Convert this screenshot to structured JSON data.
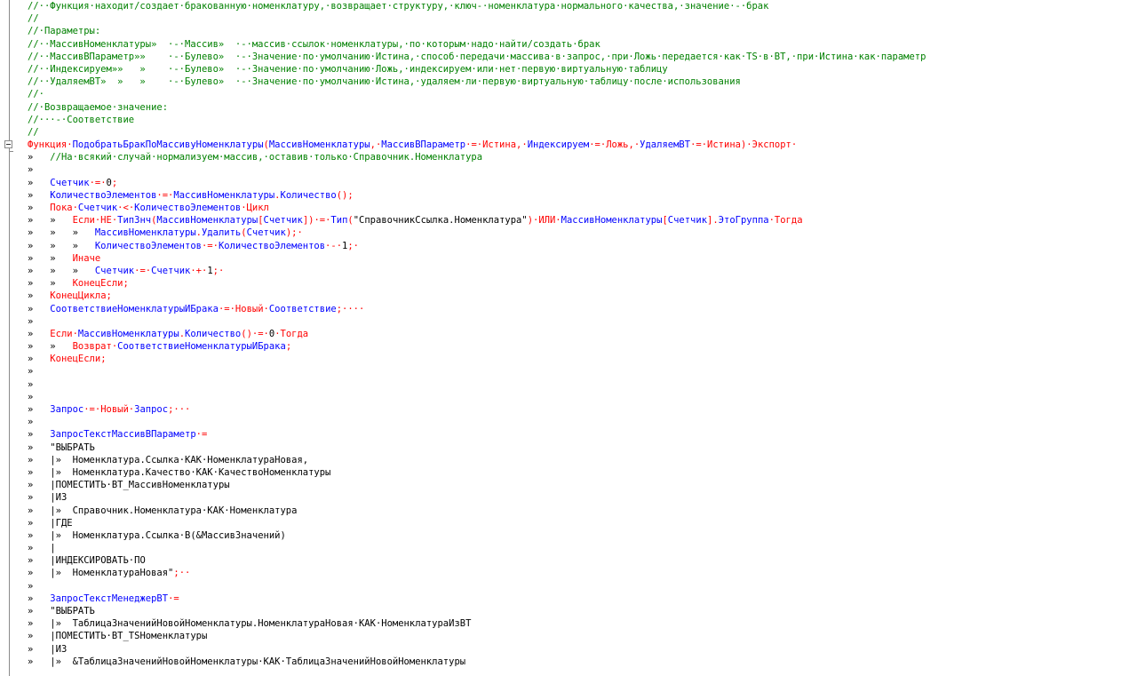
{
  "editor": {
    "lines": [
      [
        {
          "t": "//··Функция·находит/создает·бракованную·номенклатуру,·возвращает·структуру,·ключ-·номенклатура·нормального·качества,·значение·-·брак",
          "c": "c"
        }
      ],
      [
        {
          "t": "//",
          "c": "c"
        }
      ],
      [
        {
          "t": "//·Параметры:",
          "c": "c"
        }
      ],
      [
        {
          "t": "//··МассивНоменклатуры»  ·-·Массив»  ·-·массив·ссылок·номенклатуры,·по·которым·надо·найти/создать·брак",
          "c": "c"
        }
      ],
      [
        {
          "t": "//··МассивВПараметр»»    ·-·Булево»  ·-·Значение·по·умолчанию·Истина,·способ·передачи·массива·в·запрос,·при·Ложь·передается·как·TS·в·ВТ,·при·Истина·как·параметр",
          "c": "c"
        }
      ],
      [
        {
          "t": "//··Индексируем»»   »    ·-·Булево»  ·-·Значение·по·умолчанию·Ложь,·индексируем·или·нет·первую·виртуальную·таблицу",
          "c": "c"
        }
      ],
      [
        {
          "t": "//··УдаляемВТ»  »   »    ·-·Булево»  ·-·Значение·по·умолчанию·Истина,·удаляем·ли·первую·виртуальную·таблицу·после·использования",
          "c": "c"
        }
      ],
      [
        {
          "t": "//·",
          "c": "c"
        }
      ],
      [
        {
          "t": "//·Возвращаемое·значение:",
          "c": "c"
        }
      ],
      [
        {
          "t": "//···-·Соответствие",
          "c": "c"
        }
      ],
      [
        {
          "t": "//",
          "c": "c"
        }
      ],
      [
        {
          "t": "Функция·",
          "c": "k"
        },
        {
          "t": "ПодобратьБракПоМассивуНоменклатуры",
          "c": "i"
        },
        {
          "t": "(",
          "c": "o"
        },
        {
          "t": "МассивНоменклатуры",
          "c": "i"
        },
        {
          "t": ",·",
          "c": "o"
        },
        {
          "t": "МассивВПараметр",
          "c": "i"
        },
        {
          "t": "·=·",
          "c": "o"
        },
        {
          "t": "Истина",
          "c": "k"
        },
        {
          "t": ",·",
          "c": "o"
        },
        {
          "t": "Индексируем",
          "c": "i"
        },
        {
          "t": "·=·",
          "c": "o"
        },
        {
          "t": "Ложь",
          "c": "k"
        },
        {
          "t": ",·",
          "c": "o"
        },
        {
          "t": "УдаляемВТ",
          "c": "i"
        },
        {
          "t": "·=·",
          "c": "o"
        },
        {
          "t": "Истина",
          "c": "k"
        },
        {
          "t": ")·",
          "c": "o"
        },
        {
          "t": "Экспорт",
          "c": "k"
        },
        {
          "t": "·",
          "c": "o"
        }
      ],
      [
        {
          "t": "»   ",
          "c": "n"
        },
        {
          "t": "//На·всякий·случай·нормализуем·массив,·оставив·только·Справочник.Номенклатура",
          "c": "c"
        }
      ],
      [
        {
          "t": "»",
          "c": "n"
        }
      ],
      [
        {
          "t": "»   ",
          "c": "n"
        },
        {
          "t": "Счетчик",
          "c": "i"
        },
        {
          "t": "·=·",
          "c": "o"
        },
        {
          "t": "0",
          "c": "n"
        },
        {
          "t": ";",
          "c": "o"
        }
      ],
      [
        {
          "t": "»   ",
          "c": "n"
        },
        {
          "t": "КоличествоЭлементов",
          "c": "i"
        },
        {
          "t": "·=·",
          "c": "o"
        },
        {
          "t": "МассивНоменклатуры",
          "c": "i"
        },
        {
          "t": ".",
          "c": "o"
        },
        {
          "t": "Количество",
          "c": "i"
        },
        {
          "t": "();",
          "c": "o"
        }
      ],
      [
        {
          "t": "»   ",
          "c": "n"
        },
        {
          "t": "Пока·",
          "c": "k"
        },
        {
          "t": "Счетчик",
          "c": "i"
        },
        {
          "t": "·<·",
          "c": "o"
        },
        {
          "t": "КоличествоЭлементов",
          "c": "i"
        },
        {
          "t": "·Цикл",
          "c": "k"
        }
      ],
      [
        {
          "t": "»   »   ",
          "c": "n"
        },
        {
          "t": "Если·НЕ·",
          "c": "k"
        },
        {
          "t": "ТипЗнч",
          "c": "i"
        },
        {
          "t": "(",
          "c": "o"
        },
        {
          "t": "МассивНоменклатуры",
          "c": "i"
        },
        {
          "t": "[",
          "c": "o"
        },
        {
          "t": "Счетчик",
          "c": "i"
        },
        {
          "t": "])·=·",
          "c": "o"
        },
        {
          "t": "Тип",
          "c": "i"
        },
        {
          "t": "(",
          "c": "o"
        },
        {
          "t": "\"СправочникСсылка.Номенклатура\"",
          "c": "s"
        },
        {
          "t": ")·",
          "c": "o"
        },
        {
          "t": "ИЛИ·",
          "c": "k"
        },
        {
          "t": "МассивНоменклатуры",
          "c": "i"
        },
        {
          "t": "[",
          "c": "o"
        },
        {
          "t": "Счетчик",
          "c": "i"
        },
        {
          "t": "].",
          "c": "o"
        },
        {
          "t": "ЭтоГруппа",
          "c": "i"
        },
        {
          "t": "·Тогда",
          "c": "k"
        }
      ],
      [
        {
          "t": "»   »   »   ",
          "c": "n"
        },
        {
          "t": "МассивНоменклатуры",
          "c": "i"
        },
        {
          "t": ".",
          "c": "o"
        },
        {
          "t": "Удалить",
          "c": "i"
        },
        {
          "t": "(",
          "c": "o"
        },
        {
          "t": "Счетчик",
          "c": "i"
        },
        {
          "t": ");·",
          "c": "o"
        }
      ],
      [
        {
          "t": "»   »   »   ",
          "c": "n"
        },
        {
          "t": "КоличествоЭлементов",
          "c": "i"
        },
        {
          "t": "·=·",
          "c": "o"
        },
        {
          "t": "КоличествоЭлементов",
          "c": "i"
        },
        {
          "t": "·-·",
          "c": "o"
        },
        {
          "t": "1",
          "c": "n"
        },
        {
          "t": ";·",
          "c": "o"
        }
      ],
      [
        {
          "t": "»   »   ",
          "c": "n"
        },
        {
          "t": "Иначе",
          "c": "k"
        }
      ],
      [
        {
          "t": "»   »   »   ",
          "c": "n"
        },
        {
          "t": "Счетчик",
          "c": "i"
        },
        {
          "t": "·=·",
          "c": "o"
        },
        {
          "t": "Счетчик",
          "c": "i"
        },
        {
          "t": "·+·",
          "c": "o"
        },
        {
          "t": "1",
          "c": "n"
        },
        {
          "t": ";·",
          "c": "o"
        }
      ],
      [
        {
          "t": "»   »   ",
          "c": "n"
        },
        {
          "t": "КонецЕсли;",
          "c": "k"
        }
      ],
      [
        {
          "t": "»   ",
          "c": "n"
        },
        {
          "t": "КонецЦикла;",
          "c": "k"
        }
      ],
      [
        {
          "t": "»   ",
          "c": "n"
        },
        {
          "t": "СоответствиеНоменклатурыИБрака",
          "c": "i"
        },
        {
          "t": "·=·",
          "c": "o"
        },
        {
          "t": "Новый·",
          "c": "k"
        },
        {
          "t": "Соответствие",
          "c": "i"
        },
        {
          "t": ";····",
          "c": "o"
        }
      ],
      [
        {
          "t": "»",
          "c": "n"
        }
      ],
      [
        {
          "t": "»   ",
          "c": "n"
        },
        {
          "t": "Если·",
          "c": "k"
        },
        {
          "t": "МассивНоменклатуры",
          "c": "i"
        },
        {
          "t": ".",
          "c": "o"
        },
        {
          "t": "Количество",
          "c": "i"
        },
        {
          "t": "()·=·",
          "c": "o"
        },
        {
          "t": "0",
          "c": "n"
        },
        {
          "t": "·Тогда",
          "c": "k"
        }
      ],
      [
        {
          "t": "»   »   ",
          "c": "n"
        },
        {
          "t": "Возврат·",
          "c": "k"
        },
        {
          "t": "СоответствиеНоменклатурыИБрака",
          "c": "i"
        },
        {
          "t": ";",
          "c": "o"
        }
      ],
      [
        {
          "t": "»   ",
          "c": "n"
        },
        {
          "t": "КонецЕсли;",
          "c": "k"
        }
      ],
      [
        {
          "t": "»",
          "c": "n"
        }
      ],
      [
        {
          "t": "»",
          "c": "n"
        }
      ],
      [
        {
          "t": "»",
          "c": "n"
        }
      ],
      [
        {
          "t": "»   ",
          "c": "n"
        },
        {
          "t": "Запрос",
          "c": "i"
        },
        {
          "t": "·=·",
          "c": "o"
        },
        {
          "t": "Новый·",
          "c": "k"
        },
        {
          "t": "Запрос",
          "c": "i"
        },
        {
          "t": ";···",
          "c": "o"
        }
      ],
      [
        {
          "t": "»",
          "c": "n"
        }
      ],
      [
        {
          "t": "»   ",
          "c": "n"
        },
        {
          "t": "ЗапросТекстМассивВПараметр",
          "c": "i"
        },
        {
          "t": "·=",
          "c": "o"
        }
      ],
      [
        {
          "t": "»   ",
          "c": "n"
        },
        {
          "t": "\"ВЫБРАТЬ",
          "c": "s"
        }
      ],
      [
        {
          "t": "»   ",
          "c": "n"
        },
        {
          "t": "|»  Номенклатура.Ссылка·КАК·НоменклатураНовая,",
          "c": "s"
        }
      ],
      [
        {
          "t": "»   ",
          "c": "n"
        },
        {
          "t": "|»  Номенклатура.Качество·КАК·КачествоНоменклатуры",
          "c": "s"
        }
      ],
      [
        {
          "t": "»   ",
          "c": "n"
        },
        {
          "t": "|ПОМЕСТИТЬ·ВТ_МассивНоменклатуры",
          "c": "s"
        }
      ],
      [
        {
          "t": "»   ",
          "c": "n"
        },
        {
          "t": "|ИЗ",
          "c": "s"
        }
      ],
      [
        {
          "t": "»   ",
          "c": "n"
        },
        {
          "t": "|»  Справочник.Номенклатура·КАК·Номенклатура",
          "c": "s"
        }
      ],
      [
        {
          "t": "»   ",
          "c": "n"
        },
        {
          "t": "|ГДЕ",
          "c": "s"
        }
      ],
      [
        {
          "t": "»   ",
          "c": "n"
        },
        {
          "t": "|»  Номенклатура.Ссылка·В(&МассивЗначений)",
          "c": "s"
        }
      ],
      [
        {
          "t": "»   ",
          "c": "n"
        },
        {
          "t": "|",
          "c": "s"
        }
      ],
      [
        {
          "t": "»   ",
          "c": "n"
        },
        {
          "t": "|ИНДЕКСИРОВАТЬ·ПО",
          "c": "s"
        }
      ],
      [
        {
          "t": "»   ",
          "c": "n"
        },
        {
          "t": "|»  НоменклатураНовая\"",
          "c": "s"
        },
        {
          "t": ";··",
          "c": "o"
        }
      ],
      [
        {
          "t": "»",
          "c": "n"
        }
      ],
      [
        {
          "t": "»   ",
          "c": "n"
        },
        {
          "t": "ЗапросТекстМенеджерВТ",
          "c": "i"
        },
        {
          "t": "·=",
          "c": "o"
        }
      ],
      [
        {
          "t": "»   ",
          "c": "n"
        },
        {
          "t": "\"ВЫБРАТЬ",
          "c": "s"
        }
      ],
      [
        {
          "t": "»   ",
          "c": "n"
        },
        {
          "t": "|»  ТаблицаЗначенийНовойНоменклатуры.НоменклатураНовая·КАК·НоменклатураИзВТ",
          "c": "s"
        }
      ],
      [
        {
          "t": "»   ",
          "c": "n"
        },
        {
          "t": "|ПОМЕСТИТЬ·ВТ_TSНоменклатуры",
          "c": "s"
        }
      ],
      [
        {
          "t": "»   ",
          "c": "n"
        },
        {
          "t": "|ИЗ",
          "c": "s"
        }
      ],
      [
        {
          "t": "»   ",
          "c": "n"
        },
        {
          "t": "|»  &ТаблицаЗначенийНовойНоменклатуры·КАК·ТаблицаЗначенийНовойНоменклатуры",
          "c": "s"
        }
      ]
    ]
  }
}
